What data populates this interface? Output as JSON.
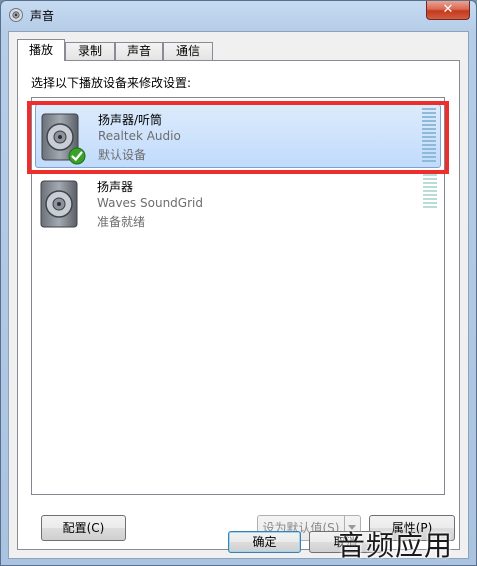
{
  "window": {
    "title": "声音",
    "close_glyph": "✕"
  },
  "tabs": [
    {
      "label": "播放",
      "active": true
    },
    {
      "label": "录制",
      "active": false
    },
    {
      "label": "声音",
      "active": false
    },
    {
      "label": "通信",
      "active": false
    }
  ],
  "panel": {
    "instruction": "选择以下播放设备来修改设置:"
  },
  "devices": [
    {
      "name": "扬声器/听筒",
      "driver": "Realtek Audio",
      "status": "默认设备",
      "selected": true,
      "icon": "speaker-icon",
      "badge": "default-check-icon"
    },
    {
      "name": "扬声器",
      "driver": "Waves SoundGrid",
      "status": "准备就绪",
      "selected": false,
      "icon": "speaker-icon"
    }
  ],
  "buttons": {
    "configure": "配置(C)",
    "set_default": "设为默认值(S)",
    "properties": "属性(P)",
    "ok": "确定",
    "cancel": "取消"
  },
  "watermark": "音频应用",
  "colors": {
    "selection": "#c1dbfc",
    "highlight": "#ee2d2d",
    "check": "#3aa12a"
  }
}
